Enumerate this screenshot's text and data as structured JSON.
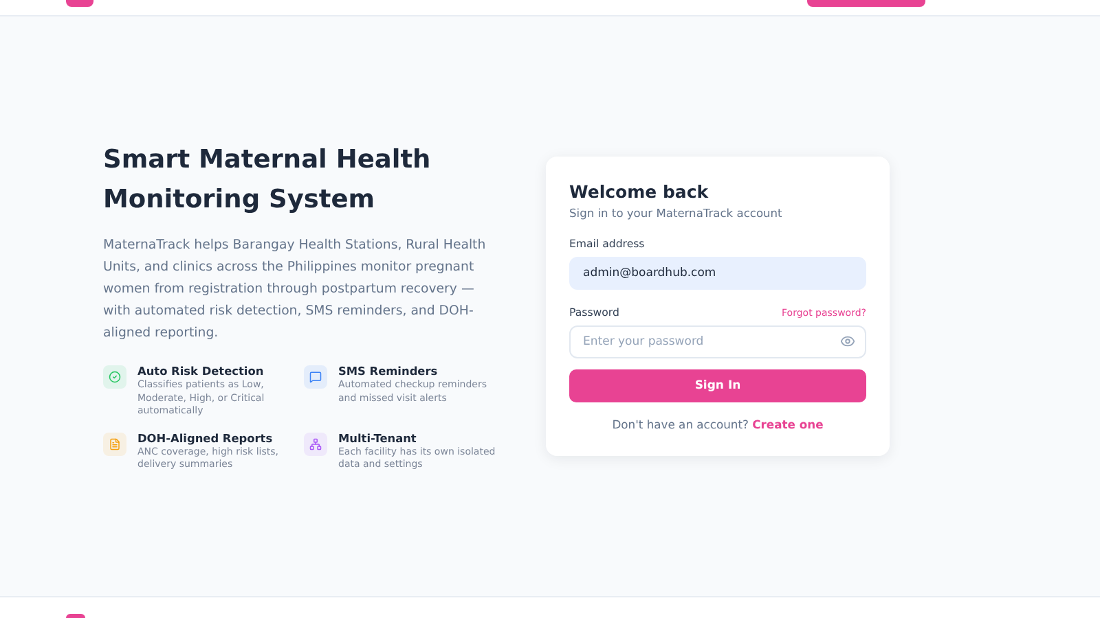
{
  "hero": {
    "title": "Smart Maternal Health Monitoring System",
    "description": "MaternaTrack helps Barangay Health Stations, Rural Health Units, and clinics across the Philippines monitor pregnant women from registration through postpartum recovery — with automated risk detection, SMS reminders, and DOH-aligned reporting."
  },
  "features": [
    {
      "kind": "risk",
      "title": "Auto Risk Detection",
      "description": "Classifies patients as Low, Moderate, High, or Critical automatically",
      "color": "#22c55e"
    },
    {
      "kind": "sms",
      "title": "SMS Reminders",
      "description": "Automated checkup reminders and missed visit alerts",
      "color": "#3b82f6"
    },
    {
      "kind": "reports",
      "title": "DOH-Aligned Reports",
      "description": "ANC coverage, high risk lists, delivery summaries",
      "color": "#f59e0b"
    },
    {
      "kind": "tenant",
      "title": "Multi-Tenant",
      "description": "Each facility has its own isolated data and settings",
      "color": "#a855f7"
    }
  ],
  "login": {
    "title": "Welcome back",
    "subtitle": "Sign in to your MaternaTrack account",
    "email": {
      "label": "Email address",
      "value": "admin@boardhub.com"
    },
    "password": {
      "label": "Password",
      "placeholder": "Enter your password",
      "forgot": "Forgot password?"
    },
    "submit": "Sign In",
    "signup_prompt": "Don't have an account?",
    "signup_link": "Create one"
  }
}
